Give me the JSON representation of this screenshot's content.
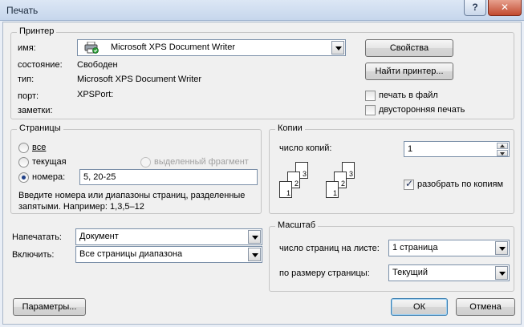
{
  "window": {
    "title": "Печать",
    "help_label": "?",
    "close_label": "✕"
  },
  "printer": {
    "group_label": "Принтер",
    "name_label": "имя:",
    "name_value": "Microsoft XPS Document Writer",
    "status_label": "состояние:",
    "status_value": "Свободен",
    "type_label": "тип:",
    "type_value": "Microsoft XPS Document Writer",
    "port_label": "порт:",
    "port_value": "XPSPort:",
    "notes_label": "заметки:",
    "properties_button": "Свойства",
    "find_printer_button": "Найти принтер...",
    "print_to_file_label": "печать в файл",
    "print_to_file_checked": false,
    "duplex_label": "двусторонняя печать",
    "duplex_checked": false,
    "icon": "printer-icon"
  },
  "pages": {
    "group_label": "Страницы",
    "all_label": "все",
    "current_label": "текущая",
    "selection_label": "выделенный фрагмент",
    "pages_label": "номера:",
    "pages_value": "5, 20-25",
    "selected_option": "pages",
    "hint_line1": "Введите номера или диапазоны страниц, разделенные",
    "hint_line2": "запятыми. Например: 1,3,5–12"
  },
  "copies": {
    "group_label": "Копии",
    "count_label": "число копий:",
    "count_value": "1",
    "collate_label": "разобрать по копиям",
    "collate_checked": true,
    "collate_icon_pages": [
      "1",
      "2",
      "3"
    ]
  },
  "print_what": {
    "label": "Напечатать:",
    "value": "Документ"
  },
  "include": {
    "label": "Включить:",
    "value": "Все страницы диапазона"
  },
  "zoom": {
    "group_label": "Масштаб",
    "pages_per_sheet_label": "число страниц на листе:",
    "pages_per_sheet_value": "1 страница",
    "scale_label": "по размеру страницы:",
    "scale_value": "Текущий"
  },
  "footer": {
    "options_button": "Параметры...",
    "ok_button": "ОК",
    "cancel_button": "Отмена"
  }
}
